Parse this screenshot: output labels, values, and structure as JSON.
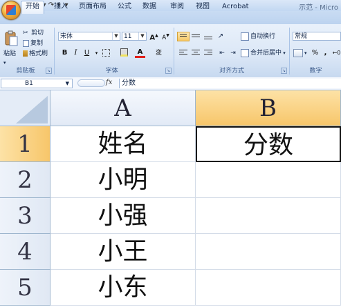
{
  "window": {
    "title": "示范 - Micro"
  },
  "tabs": [
    "开始",
    "插入",
    "页面布局",
    "公式",
    "数据",
    "审阅",
    "视图",
    "Acrobat"
  ],
  "clipboard": {
    "paste": "粘贴",
    "cut": "剪切",
    "copy": "复制",
    "format_painter": "格式刷",
    "group_label": "剪贴板"
  },
  "font": {
    "name": "宋体",
    "size": "11",
    "grow": "A",
    "shrink": "A",
    "bold": "B",
    "italic": "I",
    "underline": "U",
    "font_color_glyph": "A",
    "phonetic_glyph": "変",
    "group_label": "字体"
  },
  "alignment": {
    "wrap_text": "自动换行",
    "merge_center": "合并后居中",
    "group_label": "对齐方式"
  },
  "number": {
    "format": "常规",
    "percent": "%",
    "comma": ",",
    "group_label": "数字"
  },
  "formula_bar": {
    "name_box": "B1",
    "fx": "fx",
    "value": "分数"
  },
  "sheet": {
    "columns": [
      "A",
      "B"
    ],
    "rows": [
      {
        "num": "1",
        "A": "姓名",
        "B": "分数"
      },
      {
        "num": "2",
        "A": "小明",
        "B": ""
      },
      {
        "num": "3",
        "A": "小强",
        "B": ""
      },
      {
        "num": "4",
        "A": "小王",
        "B": ""
      },
      {
        "num": "5",
        "A": "小东",
        "B": ""
      }
    ],
    "selected_cell": "B1"
  },
  "colors": {
    "selected_header": "#f7c66a",
    "ribbon": "#dbe7f6"
  }
}
